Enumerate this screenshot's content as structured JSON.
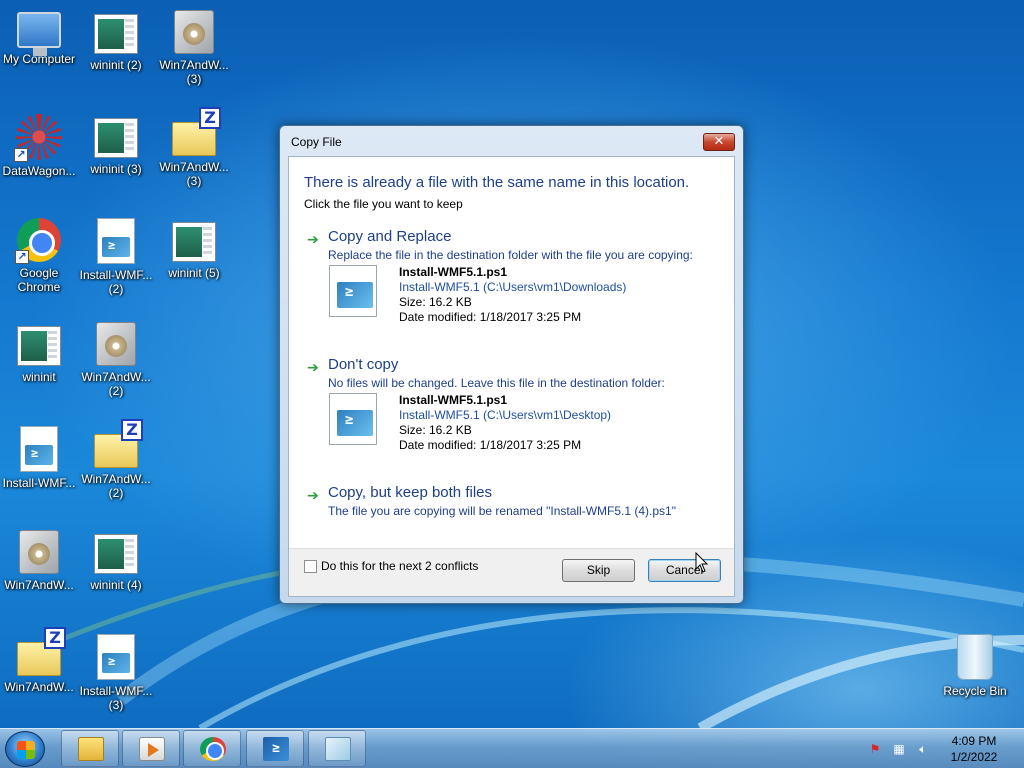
{
  "desktop": {
    "icons": [
      {
        "label": "My Computer",
        "label2": "",
        "icon": "computer-icon"
      },
      {
        "label": "wininit (2)",
        "label2": "",
        "icon": "window-icon"
      },
      {
        "label": "Win7AndW...",
        "label2": "(3)",
        "icon": "setup-icon"
      },
      {
        "label": "DataWagon...",
        "label2": "",
        "icon": "molecule-icon"
      },
      {
        "label": "wininit (3)",
        "label2": "",
        "icon": "window-icon"
      },
      {
        "label": "Win7AndW...",
        "label2": "(3)",
        "icon": "zip-folder-icon"
      },
      {
        "label": "Google",
        "label2": "Chrome",
        "icon": "chrome-icon"
      },
      {
        "label": "Install-WMF...",
        "label2": "(2)",
        "icon": "powershell-script-icon"
      },
      {
        "label": "wininit (5)",
        "label2": "",
        "icon": "window-icon"
      },
      {
        "label": "wininit",
        "label2": "",
        "icon": "window-icon"
      },
      {
        "label": "Win7AndW...",
        "label2": "(2)",
        "icon": "setup-icon"
      },
      {
        "label": "Install-WMF...",
        "label2": "",
        "icon": "powershell-script-icon"
      },
      {
        "label": "Win7AndW...",
        "label2": "(2)",
        "icon": "zip-folder-icon"
      },
      {
        "label": "Win7AndW...",
        "label2": "",
        "icon": "setup-icon"
      },
      {
        "label": "wininit (4)",
        "label2": "",
        "icon": "window-icon"
      },
      {
        "label": "Win7AndW...",
        "label2": "",
        "icon": "zip-folder-icon"
      },
      {
        "label": "Install-WMF...",
        "label2": "(3)",
        "icon": "powershell-script-icon"
      },
      {
        "label": "Recycle Bin",
        "label2": "",
        "icon": "recycle-bin-icon"
      }
    ]
  },
  "dialog": {
    "title": "Copy File",
    "close_glyph": "✕",
    "heading": "There is already a file with the same name in this location.",
    "subheading": "Click the file you want to keep",
    "options": [
      {
        "title": "Copy and Replace",
        "description": "Replace the file in the destination folder with the file you are copying:",
        "file": {
          "name": "Install-WMF5.1.ps1",
          "path": "Install-WMF5.1 (C:\\Users\\vm1\\Downloads)",
          "size": "Size: 16.2 KB",
          "modified": "Date modified: 1/18/2017 3:25 PM"
        }
      },
      {
        "title": "Don't copy",
        "description": "No files will be changed. Leave this file in the destination folder:",
        "file": {
          "name": "Install-WMF5.1.ps1",
          "path": "Install-WMF5.1 (C:\\Users\\vm1\\Desktop)",
          "size": "Size: 16.2 KB",
          "modified": "Date modified: 1/18/2017 3:25 PM"
        }
      },
      {
        "title": "Copy, but keep both files",
        "description": "The file you are copying will be renamed \"Install-WMF5.1 (4).ps1\""
      }
    ],
    "checkbox_label": "Do this for the next 2 conflicts",
    "checkbox_checked": false,
    "skip_label": "Skip",
    "cancel_label": "Cancel",
    "arrow_glyph": "➔",
    "ps_glyph": "≥"
  },
  "taskbar": {
    "pinned": [
      "folder-icon",
      "media-player-icon",
      "chrome-icon",
      "powershell-icon",
      "notepad-icon"
    ],
    "clock": {
      "time": "4:09 PM",
      "date": "1/2/2022"
    }
  },
  "colors": {
    "accent_text": "#1e3f8a",
    "close_red": "#c7472e",
    "desktop_blue": "#1478cf"
  }
}
